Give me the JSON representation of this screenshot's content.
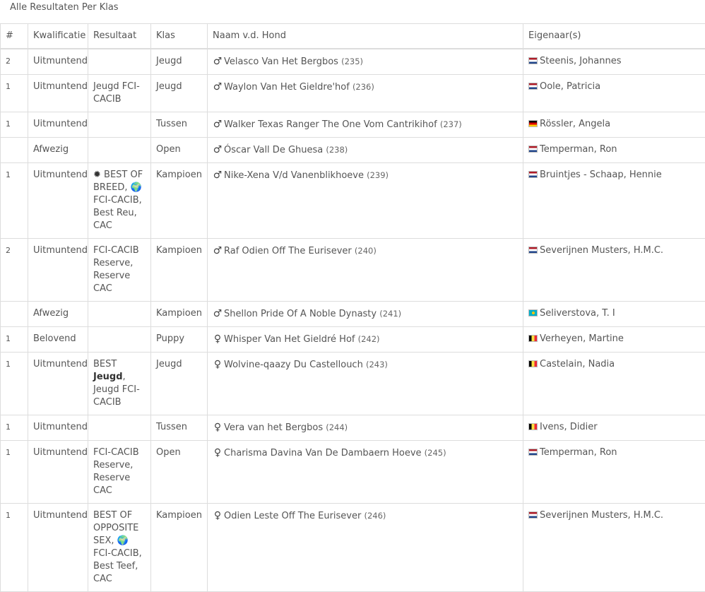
{
  "page": {
    "title": "Alle Resultaten Per Klas"
  },
  "table": {
    "headers": {
      "rank": "#",
      "qualification": "Kwalificatie",
      "result": "Resultaat",
      "class": "Klas",
      "dog": "Naam v.d. Hond",
      "owner": "Eigenaar(s)"
    },
    "rows": [
      {
        "rank": "2",
        "qualification": "Uitmuntend",
        "result": [],
        "class": "Jeugd",
        "sex": "male",
        "dog": "Velasco Van Het Bergbos",
        "catno": "(235)",
        "flag": "nl",
        "owner": "Steenis, Johannes"
      },
      {
        "rank": "1",
        "qualification": "Uitmuntend",
        "result": [
          {
            "t": "Jeugd FCI-CACIB"
          }
        ],
        "class": "Jeugd",
        "sex": "male",
        "dog": "Waylon Van Het Gieldre'hof",
        "catno": "(236)",
        "flag": "nl",
        "owner": "Oole, Patricia"
      },
      {
        "rank": "1",
        "qualification": "Uitmuntend",
        "result": [],
        "class": "Tussen",
        "sex": "male",
        "dog": "Walker Texas Ranger The One Vom Cantrikihof",
        "catno": "(237)",
        "flag": "de",
        "owner": "Rössler, Angela"
      },
      {
        "rank": "",
        "qualification": "Afwezig",
        "result": [],
        "class": "Open",
        "sex": "male",
        "dog": "Óscar Vall De Ghuesa",
        "catno": "(238)",
        "flag": "nl",
        "owner": "Temperman, Ron"
      },
      {
        "rank": "1",
        "qualification": "Uitmuntend",
        "result": [
          {
            "icon": "✹"
          },
          {
            "t": " BEST OF BREED, "
          },
          {
            "icon": "🌍"
          },
          {
            "t": " FCI-CACIB, Best Reu, CAC"
          }
        ],
        "class": "Kampioen",
        "sex": "male",
        "dog": "Nike-Xena V/d Vanenblikhoeve",
        "catno": "(239)",
        "flag": "nl",
        "owner": "Bruintjes - Schaap, Hennie"
      },
      {
        "rank": "2",
        "qualification": "Uitmuntend",
        "result": [
          {
            "t": "FCI-CACIB Reserve, Reserve CAC"
          }
        ],
        "class": "Kampioen",
        "sex": "male",
        "dog": "Raf Odien Off The Eurisever",
        "catno": "(240)",
        "flag": "nl",
        "owner": "Severijnen Musters, H.M.C."
      },
      {
        "rank": "",
        "qualification": "Afwezig",
        "result": [],
        "class": "Kampioen",
        "sex": "male",
        "dog": "Shellon Pride Of A Noble Dynasty",
        "catno": "(241)",
        "flag": "kz",
        "owner": "Seliverstova, T. I"
      },
      {
        "rank": "1",
        "qualification": "Belovend",
        "result": [],
        "class": "Puppy",
        "sex": "female",
        "dog": "Whisper Van Het Gieldré Hof",
        "catno": "(242)",
        "flag": "be",
        "owner": "Verheyen, Martine"
      },
      {
        "rank": "1",
        "qualification": "Uitmuntend",
        "result": [
          {
            "t": "BEST "
          },
          {
            "b": "Jeugd"
          },
          {
            "t": ", Jeugd FCI-CACIB"
          }
        ],
        "class": "Jeugd",
        "sex": "female",
        "dog": "Wolvine-qaazy Du Castellouch",
        "catno": "(243)",
        "flag": "be",
        "owner": "Castelain, Nadia"
      },
      {
        "rank": "1",
        "qualification": "Uitmuntend",
        "result": [],
        "class": "Tussen",
        "sex": "female",
        "dog": "Vera van het Bergbos",
        "catno": "(244)",
        "flag": "be",
        "owner": "Ivens, Didier"
      },
      {
        "rank": "1",
        "qualification": "Uitmuntend",
        "result": [
          {
            "t": "FCI-CACIB Reserve, Reserve CAC"
          }
        ],
        "class": "Open",
        "sex": "female",
        "dog": "Charisma Davina Van De Dambaern Hoeve",
        "catno": "(245)",
        "flag": "nl",
        "owner": "Temperman, Ron"
      },
      {
        "rank": "1",
        "qualification": "Uitmuntend",
        "result": [
          {
            "t": "BEST OF OPPOSITE SEX, "
          },
          {
            "icon": "🌍"
          },
          {
            "t": " FCI-CACIB, Best Teef, CAC"
          }
        ],
        "class": "Kampioen",
        "sex": "female",
        "dog": "Odien Leste Off The Eurisever",
        "catno": "(246)",
        "flag": "nl",
        "owner": "Severijnen Musters, H.M.C."
      }
    ]
  }
}
